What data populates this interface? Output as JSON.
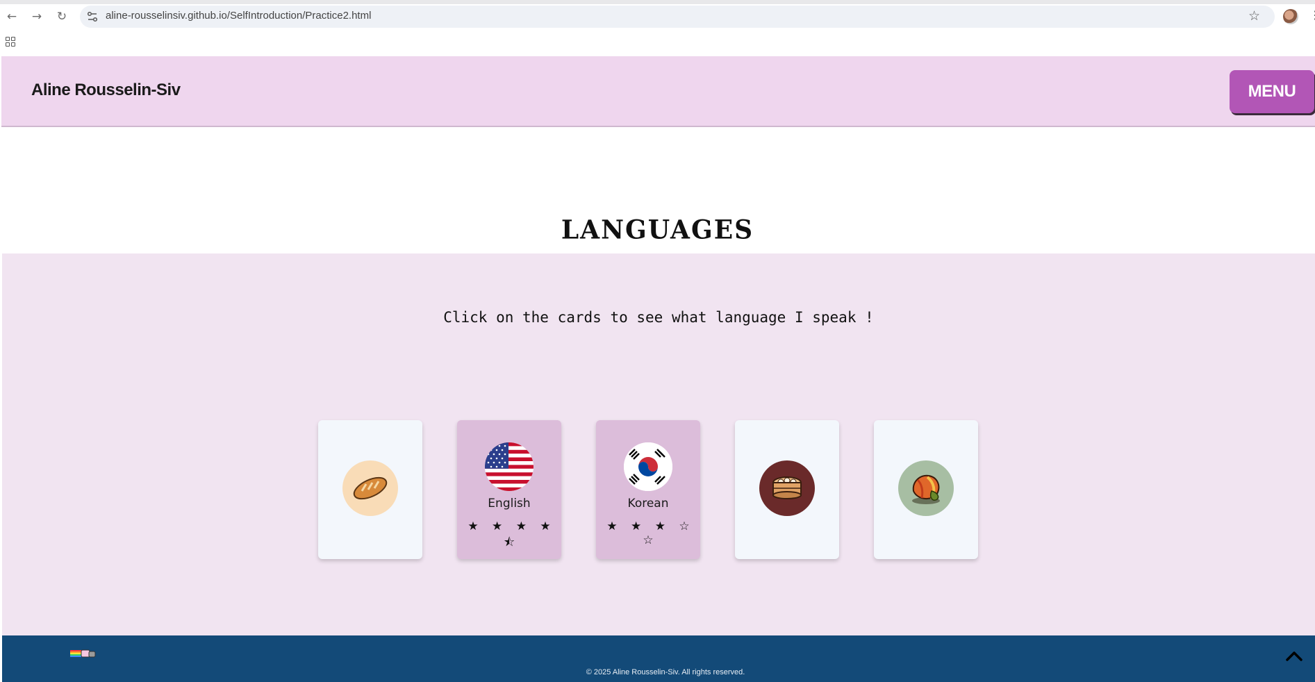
{
  "browser": {
    "url": "aline-rousselinsiv.github.io/SelfIntroduction/Practice2.html"
  },
  "header": {
    "brand": "Aline Rousselin-Siv",
    "menu_label": "MENU"
  },
  "section": {
    "title": "LANGUAGES",
    "subtitle": "Click on the cards to see what language I speak !"
  },
  "cards": [
    {
      "state": "front",
      "icon": "bread-icon",
      "circle_color": "#f9dcb7"
    },
    {
      "state": "flipped",
      "icon": "us-flag-icon",
      "label": "English",
      "stars": "★ ★ ★ ★ ⯪",
      "rating": 4.5
    },
    {
      "state": "flipped",
      "icon": "korea-flag-icon",
      "label": "Korean",
      "stars": "★ ★ ★ ☆ ☆",
      "rating": 3
    },
    {
      "state": "front",
      "icon": "dumpling-basket-icon",
      "circle_color": "#6a2a2a"
    },
    {
      "state": "front",
      "icon": "kimchi-icon",
      "circle_color": "#a7bea3"
    }
  ],
  "footer": {
    "copyright": "© 2025 Aline Rousselin-Siv. All rights reserved."
  },
  "colors": {
    "header_bg": "#efd6ee",
    "menu_button": "#b256b6",
    "section_bg": "#f1e4f1",
    "card_front": "#f3f7fc",
    "card_flipped": "#dcbdda",
    "footer_bg": "#134a78"
  }
}
